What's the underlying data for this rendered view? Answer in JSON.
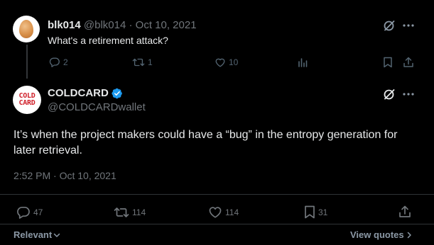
{
  "parent_tweet": {
    "display_name": "blk014",
    "handle": "@blk014",
    "separator": "·",
    "date": "Oct 10, 2021",
    "text": "What's a retirement attack?",
    "actions": {
      "replies": "2",
      "retweets": "1",
      "likes": "10"
    },
    "more_icon": "ellipsis-icon",
    "grok_icon": "grok-icon"
  },
  "main_tweet": {
    "display_name": "COLDCARD",
    "handle": "@COLDCARDwallet",
    "avatar_text_line1": "COLD",
    "avatar_text_line2": "CARD",
    "text": "It’s when the project makers could have a “bug” in the entropy generation for later retrieval.",
    "timestamp": "2:52 PM · Oct 10, 2021",
    "actions": {
      "replies": "47",
      "retweets": "114",
      "likes": "114",
      "bookmarks": "31"
    },
    "verified_color": "#1d9bf0"
  },
  "footer": {
    "sort_label": "Relevant",
    "quotes_label": "View quotes"
  },
  "colors": {
    "background": "#000000",
    "text": "#e7e9ea",
    "muted": "#71767b",
    "divider": "#2f3336",
    "verified": "#1d9bf0",
    "brand_red": "#d0202a"
  }
}
